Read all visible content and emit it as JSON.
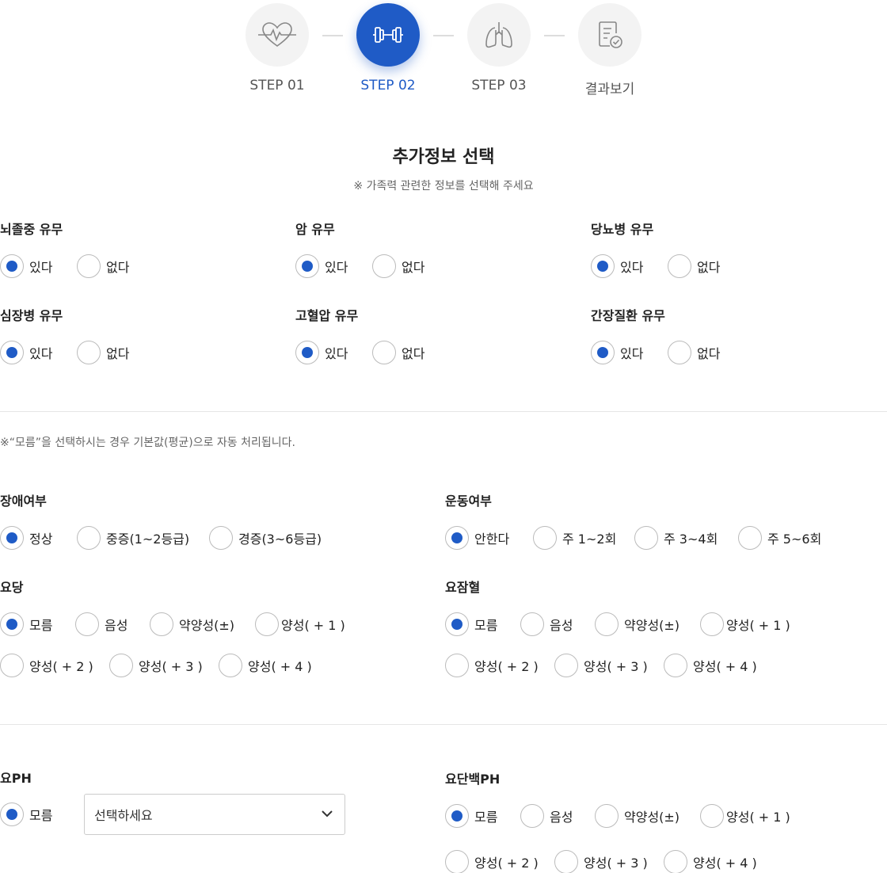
{
  "steps": [
    {
      "label": "STEP 01",
      "icon": "heart-pulse-icon"
    },
    {
      "label": "STEP 02",
      "icon": "dumbbell-icon"
    },
    {
      "label": "STEP 03",
      "icon": "lungs-icon"
    },
    {
      "label": "결과보기",
      "icon": "report-check-icon"
    }
  ],
  "active_step": 2,
  "accent_color": "#1f5bc6",
  "heading": {
    "title": "추가정보 선택",
    "subtitle": "※ 가족력 관련한 정보를 선택해 주세요"
  },
  "family_history": [
    {
      "label": "뇌졸중 유무",
      "options": [
        "있다",
        "없다"
      ],
      "selected": "있다"
    },
    {
      "label": "암 유무",
      "options": [
        "있다",
        "없다"
      ],
      "selected": "있다"
    },
    {
      "label": "당뇨병 유무",
      "options": [
        "있다",
        "없다"
      ],
      "selected": "있다"
    },
    {
      "label": "심장병 유무",
      "options": [
        "있다",
        "없다"
      ],
      "selected": "있다"
    },
    {
      "label": "고혈압 유무",
      "options": [
        "있다",
        "없다"
      ],
      "selected": "있다"
    },
    {
      "label": "간장질환 유무",
      "options": [
        "있다",
        "없다"
      ],
      "selected": "있다"
    }
  ],
  "note": "※“모름”을 선택하시는 경우 기본값(평균)으로 자동 처리됩니다.",
  "disability": {
    "label": "장애여부",
    "options": [
      "정상",
      "중증(1~2등급)",
      "경증(3~6등급)"
    ],
    "selected": "정상"
  },
  "exercise": {
    "label": "운동여부",
    "options": [
      "안한다",
      "주 1~2회",
      "주 3~4회",
      "주 5~6회"
    ],
    "selected": "안한다"
  },
  "urine_sugar": {
    "label": "요당",
    "options": [
      "모름",
      "음성",
      "약양성(±)",
      "양성( + 1 )",
      "양성( + 2 )",
      "양성( + 3 )",
      "양성( + 4 )"
    ],
    "selected": "모름"
  },
  "urine_blood": {
    "label": "요잠혈",
    "options": [
      "모름",
      "음성",
      "약양성(±)",
      "양성( + 1 )",
      "양성( + 2 )",
      "양성( + 3 )",
      "양성( + 4 )"
    ],
    "selected": "모름"
  },
  "urine_ph": {
    "label": "요PH",
    "options": [
      "모름"
    ],
    "selected": "모름",
    "select_placeholder": "선택하세요"
  },
  "urine_protein": {
    "label": "요단백PH",
    "options": [
      "모름",
      "음성",
      "약양성(±)",
      "양성( + 1 )",
      "양성( + 2 )",
      "양성( + 3 )",
      "양성( + 4 )"
    ],
    "selected": "모름"
  }
}
